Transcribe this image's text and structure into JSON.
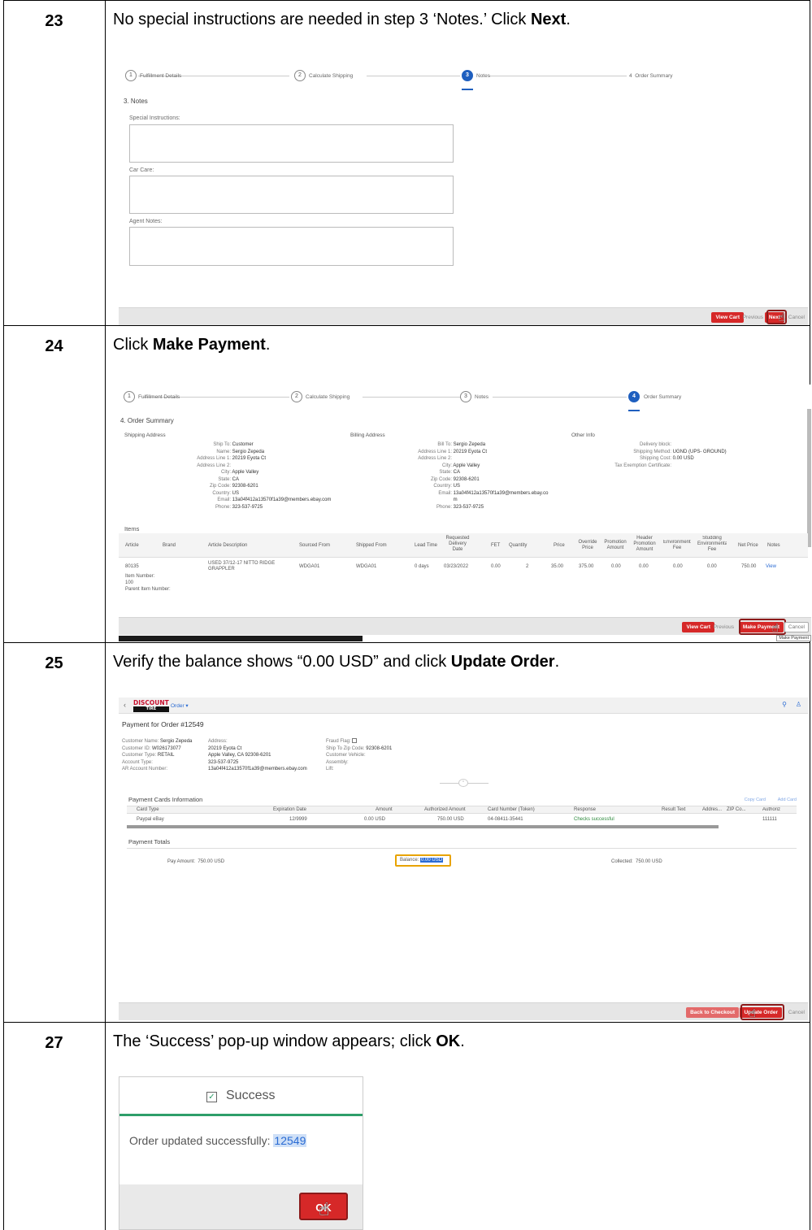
{
  "rows": [
    {
      "step": "23",
      "instruction_pre": "No special instructions are needed in step 3 ‘Notes.’ Click ",
      "instruction_bold": "Next",
      "instruction_post": ".",
      "shot": {
        "steps": [
          {
            "num": "1",
            "label": "Fulfillment Details"
          },
          {
            "num": "2",
            "label": "Calculate Shipping"
          },
          {
            "num": "3",
            "label": "Notes"
          },
          {
            "num": "4",
            "label": "Order Summary"
          }
        ],
        "section_title": "3. Notes",
        "fields": [
          "Special Instructions:",
          "Car Care:",
          "Agent Notes:"
        ],
        "buttons": {
          "view_cart": "View Cart",
          "previous": "Previous",
          "next": "Next",
          "cancel": "Cancel"
        }
      }
    },
    {
      "step": "24",
      "instruction_pre": "Click ",
      "instruction_bold": "Make Payment",
      "instruction_post": ".",
      "shot": {
        "steps": [
          {
            "num": "1",
            "label": "Fulfillment Details"
          },
          {
            "num": "2",
            "label": "Calculate Shipping"
          },
          {
            "num": "3",
            "label": "Notes"
          },
          {
            "num": "4",
            "label": "Order Summary"
          }
        ],
        "section_title": "4. Order Summary",
        "shipping_title": "Shipping Address",
        "billing_title": "Billing Address",
        "other_title": "Other Info",
        "shipping": [
          [
            "Ship To:",
            "Customer"
          ],
          [
            "Name:",
            "Sergio Zepeda"
          ],
          [
            "Address Line 1:",
            "20219 Eyota Ct"
          ],
          [
            "Address Line 2:",
            ""
          ],
          [
            "City:",
            "Apple Valley"
          ],
          [
            "State:",
            "CA"
          ],
          [
            "Zip Code:",
            "92308-6201"
          ],
          [
            "Country:",
            "US"
          ],
          [
            "Email:",
            "13a04f412a13570f1a39@members.ebay.com"
          ],
          [
            "Phone:",
            "323-537-9725"
          ]
        ],
        "billing": [
          [
            "Bill To:",
            "Sergio Zepeda"
          ],
          [
            "Address Line 1:",
            "20219 Eyota Ct"
          ],
          [
            "Address Line 2:",
            ""
          ],
          [
            "City:",
            "Apple Valley"
          ],
          [
            "State:",
            "CA"
          ],
          [
            "Zip Code:",
            "92308-6201"
          ],
          [
            "Country:",
            "US"
          ],
          [
            "Email:",
            "13a04f412a13570f1a39@members.ebay.co"
          ],
          [
            "",
            "m"
          ],
          [
            "Phone:",
            "323-537-9725"
          ]
        ],
        "other": [
          [
            "Delivery block:",
            ""
          ],
          [
            "Shipping Method:",
            "UGND (UPS- GROUND)"
          ],
          [
            "Shipping Cost:",
            "0.00 USD"
          ],
          [
            "Tax Exemption Certificate:",
            ""
          ]
        ],
        "items_title": "Items",
        "item_headers": [
          "Article",
          "Brand",
          "Article Description",
          "Sourced From",
          "Shipped From",
          "Lead Time",
          "Requested Delivery Date",
          "FET",
          "Quantity",
          "Price",
          "Override Price",
          "Promotion Amount",
          "Header Promotion Amount",
          "Environmental Fee",
          "Studding Environmental Fee",
          "Net Price",
          "Notes"
        ],
        "item_row": [
          "80135",
          "",
          "USED 37/12-17 NITTO RIDGE GRAPPLER",
          "WDGA01",
          "WDGA01",
          "0 days",
          "03/23/2022",
          "0.00",
          "2",
          "35.00",
          "375.00",
          "0.00",
          "0.00",
          "0.00",
          "0.00",
          "750.00",
          "View"
        ],
        "item_number_label": "Item Number:",
        "item_number": "100",
        "parent_item_label": "Parent Item Number:",
        "buttons": {
          "view_cart": "View Cart",
          "previous": "Previous",
          "make_payment": "Make Payment",
          "cancel": "Cancel",
          "tooltip": "Make Payment"
        }
      }
    },
    {
      "step": "25",
      "instruction_pre": "Verify the balance shows “0.00 USD” and click ",
      "instruction_bold": "Update Order",
      "instruction_post": ".",
      "shot": {
        "logo_top": "DISCOUNT",
        "logo_bottom": "TIRE",
        "nav_menu": "Order ▾",
        "title": "Payment for Order #12549",
        "customer": [
          [
            "Customer Name:",
            "Sergio Zepeda"
          ],
          [
            "Customer ID:",
            "W026173077"
          ],
          [
            "Customer Type:",
            "RETAIL"
          ],
          [
            "Account Type:",
            ""
          ],
          [
            "AR Account Number:",
            ""
          ]
        ],
        "address_label": "Address:",
        "address_lines": [
          "20219 Eyota Ct",
          "Apple Valley, CA 92308-6201",
          "323-537-9725",
          "13a04f412a13570f1a39@members.ebay.com"
        ],
        "flags": [
          [
            "Fraud Flag:",
            ""
          ],
          [
            "Ship To Zip Code:",
            "92308-6201"
          ],
          [
            "Customer Vehicle:",
            ""
          ],
          [
            "Assembly:",
            ""
          ],
          [
            "Lift:",
            ""
          ]
        ],
        "cards_title": "Payment Cards Information",
        "copy_card": "Copy Card",
        "add_card": "Add Card",
        "card_headers": [
          "Card Type",
          "Expiration Date",
          "Amount",
          "Authorized Amount",
          "Card Number (Token)",
          "Response",
          "Result Text",
          "Addres...",
          "ZIP Co...",
          "Authoriz"
        ],
        "card_row": [
          "Paypal eBay",
          "12/9999",
          "0.00  USD",
          "750.00  USD",
          "04-08411-35441",
          "Checks successful",
          "",
          "",
          "",
          "111111"
        ],
        "totals_title": "Payment Totals",
        "pay_amount_label": "Pay Amount:",
        "pay_amount": "750.00 USD",
        "balance_label": "Balance:",
        "balance": "0.00 USD",
        "collected_label": "Collected:",
        "collected": "750.00 USD",
        "buttons": {
          "back": "Back to Checkout",
          "update": "Update Order",
          "cancel": "Cancel"
        }
      }
    },
    {
      "step": "27",
      "instruction_pre": "The ‘Success’ pop-up window appears; click ",
      "instruction_bold": "OK",
      "instruction_post": ".",
      "shot": {
        "title": "Success",
        "message": "Order updated successfully:",
        "order_no": "12549",
        "ok": "OK"
      }
    }
  ]
}
